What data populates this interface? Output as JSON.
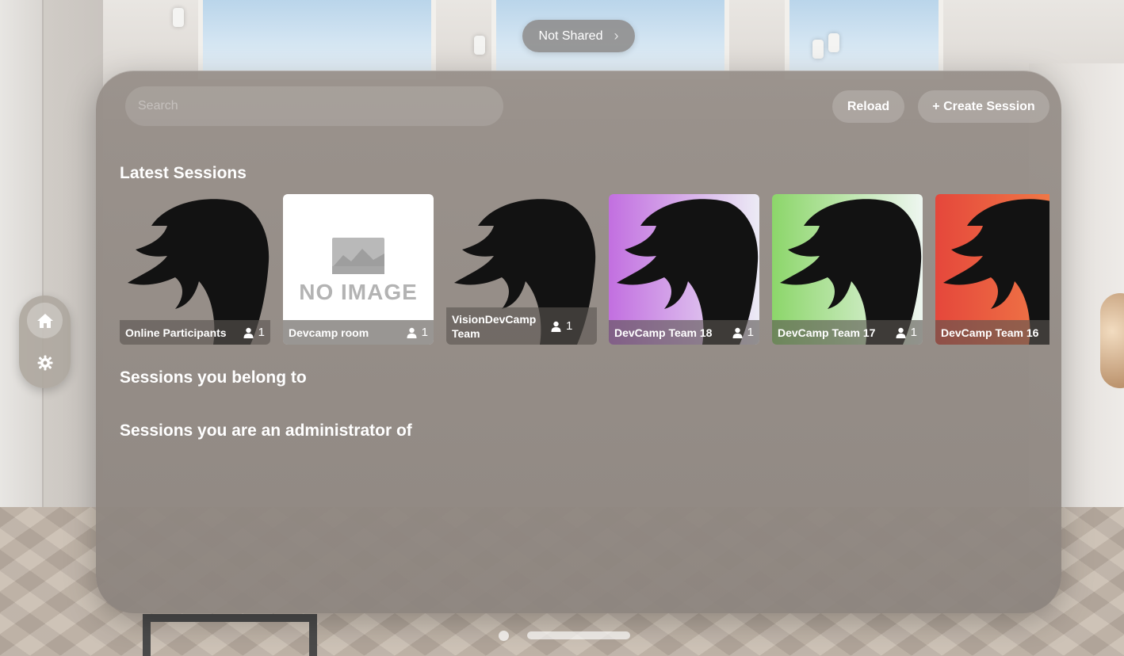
{
  "share": {
    "label": "Not Shared",
    "chevron": "›"
  },
  "search": {
    "placeholder": "Search",
    "value": ""
  },
  "toolbar": {
    "reload_label": "Reload",
    "create_label": "+ Create Session"
  },
  "sections": {
    "latest": "Latest Sessions",
    "belong": "Sessions you belong to",
    "admin": "Sessions you are an administrator of"
  },
  "sessions": [
    {
      "name": "Online Participants",
      "count": "1",
      "thumb": "logo-plain"
    },
    {
      "name": "Devcamp room",
      "count": "1",
      "thumb": "no-image",
      "no_image_text": "NO IMAGE"
    },
    {
      "name": "VisionDevCamp Team",
      "count": "1",
      "thumb": "logo-plain"
    },
    {
      "name": "DevCamp Team 18",
      "count": "1",
      "thumb": "logo-purple"
    },
    {
      "name": "DevCamp Team 17",
      "count": "1",
      "thumb": "logo-green"
    },
    {
      "name": "DevCamp Team 16",
      "count": "",
      "thumb": "logo-red"
    }
  ],
  "ornament": {
    "items": [
      "home-icon",
      "gear-icon"
    ]
  },
  "colors": {
    "purple": [
      "#c26fe0",
      "#ecebf5"
    ],
    "green": [
      "#8cd66a",
      "#eef6f0"
    ],
    "red": [
      "#e5473b",
      "#f3874a"
    ]
  }
}
